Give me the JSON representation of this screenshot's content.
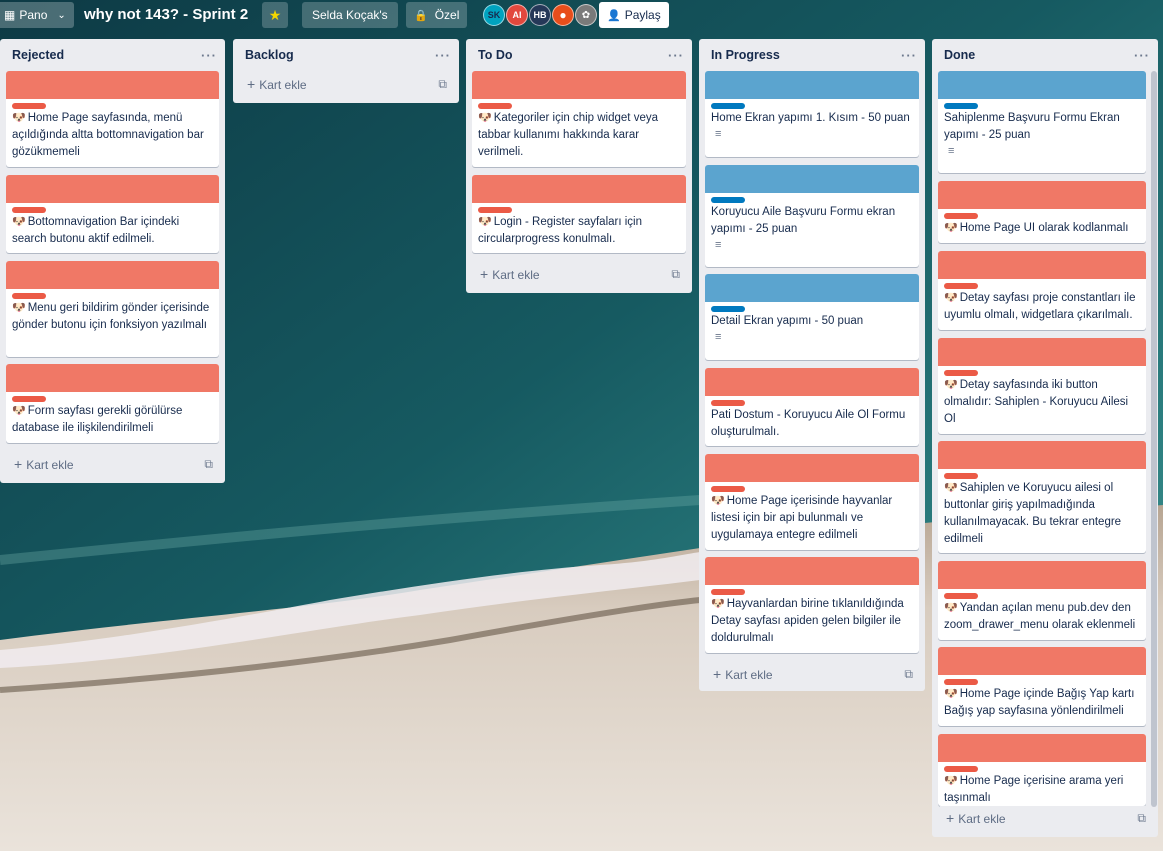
{
  "header": {
    "pano_label": "Pano",
    "board_title": "why not 143? - Sprint 2",
    "owner_label": "Selda Koçak's",
    "visibility_label": "Özel",
    "share_label": "Paylaş",
    "avatars": [
      {
        "initials": "SK",
        "color": "#00a3bf"
      },
      {
        "initials": "AI",
        "color": "#e2483d"
      },
      {
        "initials": "HB",
        "color": "#253858"
      },
      {
        "initials": "",
        "color": "#e84e1b"
      },
      {
        "initials": "",
        "color": "#6b6b6b"
      }
    ]
  },
  "colors": {
    "red": "#f07866",
    "red_label": "#eb5a46",
    "blue": "#5ba4cf",
    "blue_label": "#0079bf"
  },
  "add_card_label": "Kart ekle",
  "lists": {
    "rejected": {
      "title": "Rejected",
      "cards": [
        {
          "text": "Home Page sayfasında, menü açıldığında altta bottomnavigation bar gözükmemeli"
        },
        {
          "text": "Bottomnavigation Bar içindeki search butonu aktif edilmeli."
        },
        {
          "text": "Menu geri bildirim gönder içerisinde gönder butonu için fonksiyon yazılmalı"
        },
        {
          "text": "Form sayfası gerekli görülürse database ile ilişkilendirilmeli"
        }
      ]
    },
    "backlog": {
      "title": "Backlog"
    },
    "todo": {
      "title": "To Do",
      "cards": [
        {
          "text": "Kategoriler için chip widget veya tabbar kullanımı hakkında karar verilmeli."
        },
        {
          "text": "Login - Register sayfaları için circularprogress konulmalı."
        }
      ]
    },
    "inprogress": {
      "title": "In Progress",
      "cards": [
        {
          "text": "Home Ekran yapımı 1. Kısım - 50 puan"
        },
        {
          "text": "Koruyucu Aile Başvuru Formu ekran yapımı - 25 puan"
        },
        {
          "text": "Detail Ekran yapımı - 50 puan"
        },
        {
          "text": "Pati Dostum - Koruyucu Aile Ol Formu oluşturulmalı."
        },
        {
          "text": "Home Page içerisinde hayvanlar listesi için bir api bulunmalı ve uygulamaya entegre edilmeli"
        },
        {
          "text": "Hayvanlardan birine tıklanıldığında Detay sayfası apiden gelen bilgiler ile doldurulmalı"
        }
      ]
    },
    "done": {
      "title": "Done",
      "cards": [
        {
          "text": "Sahiplenme Başvuru Formu Ekran yapımı - 25 puan"
        },
        {
          "text": "Home Page UI olarak kodlanmalı"
        },
        {
          "text": "Detay sayfası proje constantları ile uyumlu olmalı, widgetlara çıkarılmalı."
        },
        {
          "text": "Detay sayfasında iki button olmalıdır: Sahiplen - Koruyucu Ailesi Ol"
        },
        {
          "text": "Sahiplen ve Koruyucu ailesi ol buttonlar giriş yapılmadığında kullanılmayacak. Bu tekrar entegre edilmeli"
        },
        {
          "text": "Yandan açılan menu pub.dev den zoom_drawer_menu olarak eklenmeli"
        },
        {
          "text": "Home Page içinde Bağış Yap kartı Bağış yap sayfasına yönlendirilmeli"
        },
        {
          "text": "Home Page içerisine arama yeri taşınmalı"
        }
      ]
    }
  }
}
